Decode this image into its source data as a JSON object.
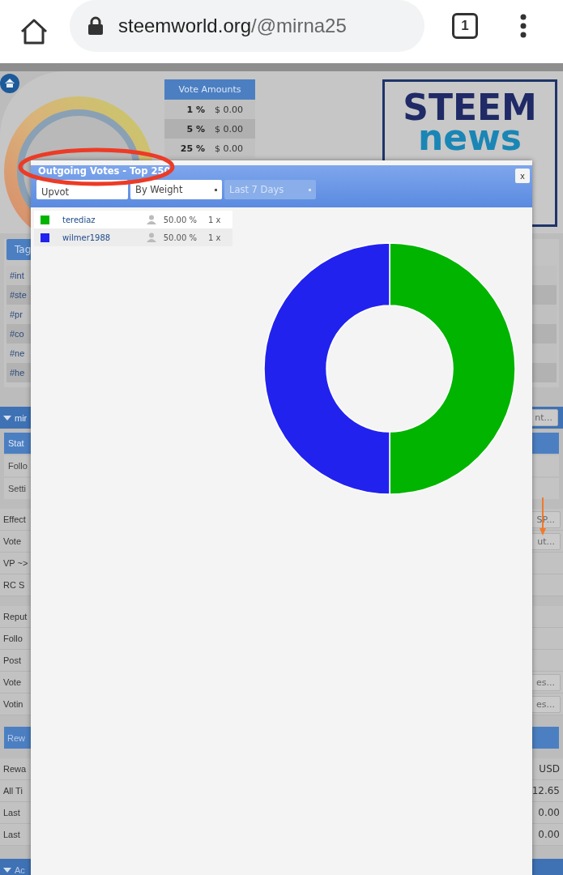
{
  "browser": {
    "domain": "steemworld.org",
    "path": "/@mirna25",
    "tab_count": "1"
  },
  "vote_amounts": {
    "title": "Vote Amounts",
    "rows": [
      {
        "percent": "1 %",
        "value": "$ 0.00"
      },
      {
        "percent": "5 %",
        "value": "$ 0.00"
      },
      {
        "percent": "25 %",
        "value": "$ 0.00"
      }
    ]
  },
  "logo": {
    "top": "STEEM",
    "bottom": "news"
  },
  "tags": {
    "button": "Tag",
    "items": [
      "#int",
      "#ste",
      "#pr",
      "#co",
      "#ne",
      "#he"
    ]
  },
  "profile_header": {
    "label": "mir",
    "right": "nt..."
  },
  "profile_tabs": [
    {
      "label": "Stat",
      "selected": true
    },
    {
      "label": "Follo",
      "selected": false
    },
    {
      "label": "Setti",
      "selected": false
    }
  ],
  "stats_groups": [
    [
      {
        "label": "Effect",
        "value": "SP..."
      },
      {
        "label": "Vote",
        "value": "ut..."
      },
      {
        "label": "VP ~>"
      },
      {
        "label": "RC S"
      }
    ],
    [
      {
        "label": "Reput"
      },
      {
        "label": "Follo"
      },
      {
        "label": "Post"
      },
      {
        "label": "Vote",
        "value": "es..."
      },
      {
        "label": "Votin",
        "value": "es..."
      }
    ]
  ],
  "rewards": {
    "header": "Rew",
    "rows": [
      {
        "label": "Rewa",
        "value": "USD"
      },
      {
        "label": "All Ti",
        "value": "12.65"
      },
      {
        "label": "Last",
        "value": "0.00"
      },
      {
        "label": "Last",
        "value": "0.00"
      }
    ]
  },
  "account_header": "Ac",
  "modal": {
    "title": "Outgoing Votes - Top 250",
    "close": "x",
    "selects": [
      {
        "label": "Upvot",
        "disabled": false
      },
      {
        "label": "By Weight",
        "disabled": false
      },
      {
        "label": "Last 7 Days",
        "disabled": true
      }
    ],
    "votes": [
      {
        "name": "terediaz",
        "color": "#00b400",
        "percent": "50.00 %",
        "count": "1 x"
      },
      {
        "name": "wilmer1988",
        "color": "#2222ee",
        "percent": "50.00 %",
        "count": "1 x"
      }
    ]
  }
}
